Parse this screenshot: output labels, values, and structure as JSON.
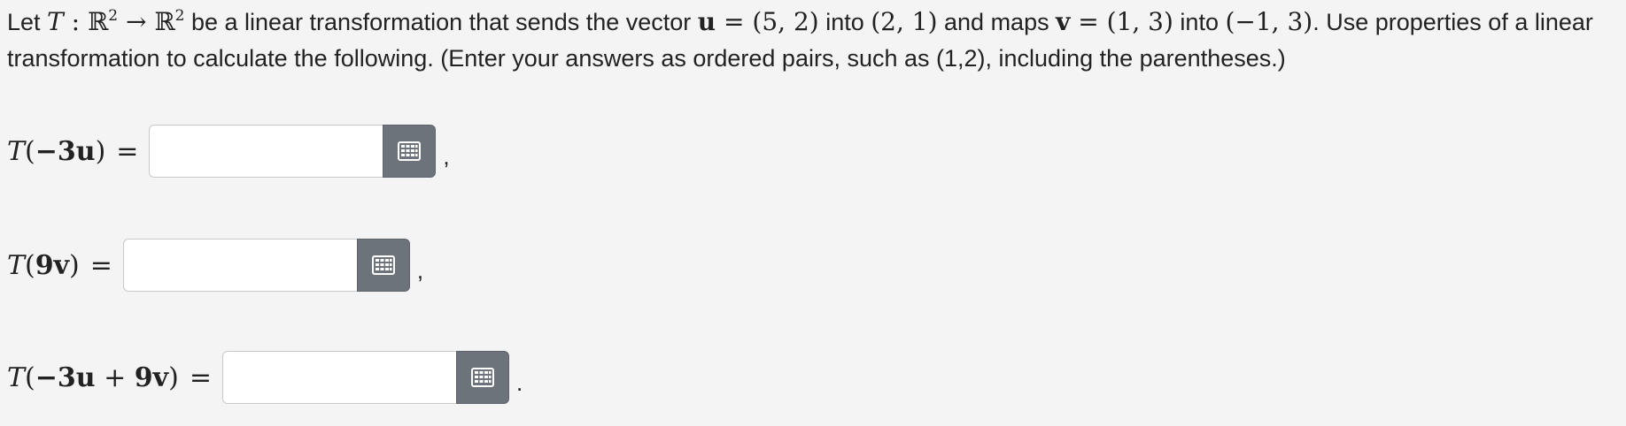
{
  "question": {
    "t1": "Let ",
    "T": "T",
    "colon": " : ",
    "R": "ℝ",
    "sup2": "2",
    "arrow": " → ",
    "t2": " be a linear transformation that sends the vector ",
    "u": "u",
    "eq": " = ",
    "u_val": "(5, 2)",
    "t3": " into ",
    "Tu_val": "(2, 1)",
    "t4": " and maps ",
    "v": "v",
    "v_val": "(1, 3)",
    "t5": " into ",
    "Tv_val": "(−1, 3)",
    "t6": ". Use properties of a linear transformation to calculate the following. (Enter your answers as ordered pairs, such as (1,2), including the parentheses.)"
  },
  "parts": [
    {
      "T": "T",
      "open": "(",
      "coef1": "−3",
      "vec1": "u",
      "close": ")",
      "equals": "=",
      "answer_value": "",
      "punct": ","
    },
    {
      "T": "T",
      "open": "(",
      "coef1": "9",
      "vec1": "v",
      "close": ")",
      "equals": "=",
      "answer_value": "",
      "punct": ","
    },
    {
      "T": "T",
      "open": "(",
      "coef1": "−3",
      "vec1": "u",
      "plus": " + ",
      "coef2": "9",
      "vec2": "v",
      "close": ")",
      "equals": "=",
      "answer_value": "",
      "punct": "."
    }
  ],
  "icons": {
    "keyboard_button": "keypad-icon"
  },
  "colors": {
    "keyboard_button_bg": "#6c737b",
    "page_bg": "#f4f4f4",
    "input_bg": "#ffffff"
  }
}
